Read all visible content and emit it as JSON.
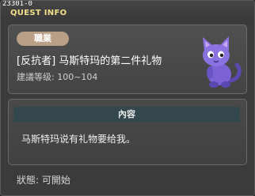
{
  "window": {
    "quest_id": "23301-0",
    "title": "QUEST INFO"
  },
  "summary": {
    "job_badge": "職業",
    "quest_name": "[反抗者] 马斯特玛的第二件礼物",
    "level_label": "建議等级:",
    "level_range": "100~104",
    "npc_icon": "purple-cat-npc-icon"
  },
  "content": {
    "header": "內容",
    "text": "马斯特玛说有礼物要给我。"
  },
  "status": {
    "label": "狀態:",
    "value": "可開始"
  },
  "colors": {
    "title": "#f3e08a",
    "badge": "#b99f86",
    "content_header": "#33474c",
    "npc": "#7b63d6"
  }
}
